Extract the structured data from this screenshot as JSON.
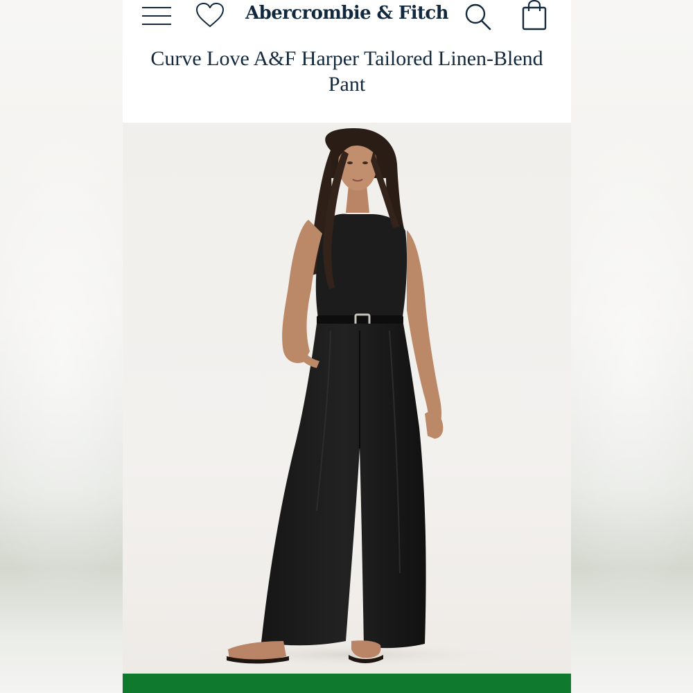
{
  "header": {
    "brand": "Abercrombie & Fitch",
    "icons": [
      "menu-icon",
      "heart-icon",
      "search-icon",
      "shopping-bag-icon"
    ]
  },
  "product": {
    "title": "Curve Love A&F Harper Tailored Linen-Blend Pant",
    "image": "product-model-photo"
  },
  "colors": {
    "navy_text": "#12283d",
    "action_bar": "#0f7a2e",
    "photo_bg": "#f1efec"
  }
}
